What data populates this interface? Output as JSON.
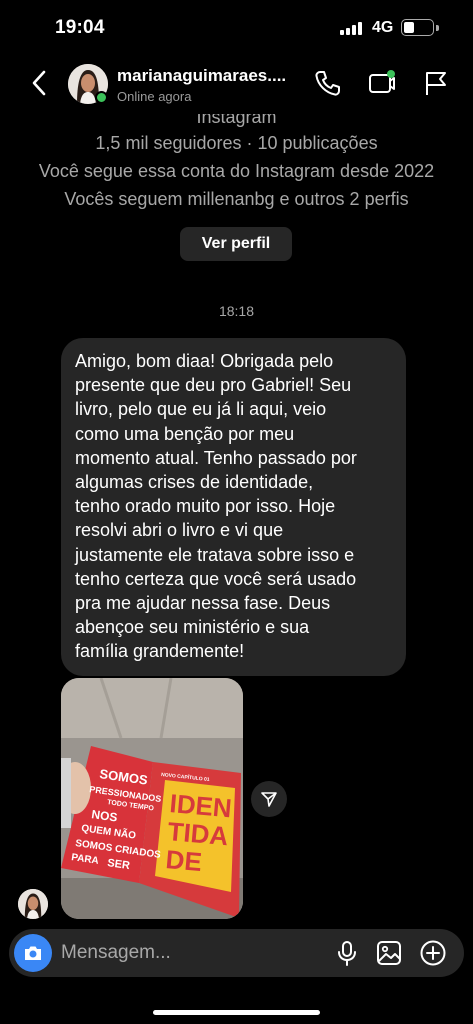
{
  "status_bar": {
    "time": "19:04",
    "network": "4G",
    "battery_level": 0.36
  },
  "header": {
    "contact_name": "marianaguimaraes....",
    "status": "Online agora",
    "icons": [
      "back-chevron-icon",
      "phone-icon",
      "video-call-icon",
      "flag-icon"
    ]
  },
  "profile": {
    "cut_label": "Instagram",
    "followers": "1,5 mil seguidores · 10 publicações",
    "following_since": "Você segue essa conta do Instagram desde 2022",
    "mutuals": "Vocês seguem millenanbg e outros 2 perfis",
    "view_profile_label": "Ver perfil"
  },
  "chat": {
    "timestamp": "18:18",
    "message_lines": [
      "Amigo, bom diaa! Obrigada pelo",
      "presente que deu pro Gabriel! Seu",
      "livro, pelo que eu já li aqui, veio",
      "como uma benção por meu",
      "momento atual. Tenho passado por",
      "algumas crises de identidade,",
      "tenho orado muito por isso. Hoje",
      "resolvi abri o livro e vi que",
      "justamente ele tratava sobre isso e",
      "tenho certeza que você será usado",
      "pra me ajudar nessa fase. Deus",
      "abençoe seu ministério e sua",
      "família grandemente!"
    ],
    "photo_text": {
      "left_page_lines": [
        "SOMOS",
        "PRESSIONADOS",
        "TODO TEMPO",
        "NOS",
        "QUEM NÃO",
        "SOMOS CRIADOS",
        "PARA",
        "SER"
      ],
      "right_page_lines": [
        "IDEN",
        "TIDA",
        "DE"
      ],
      "chapter_label": "NOVO CAPÍTULO 01"
    }
  },
  "composer": {
    "placeholder": "Mensagem...",
    "icons": [
      "camera-icon",
      "microphone-icon",
      "gallery-icon",
      "plus-circle-icon"
    ]
  },
  "colors": {
    "background": "#000000",
    "bubble": "#262626",
    "accent_blue": "#3a87f5",
    "online_green": "#3cc25a",
    "muted_text": "#a8a8a8"
  }
}
